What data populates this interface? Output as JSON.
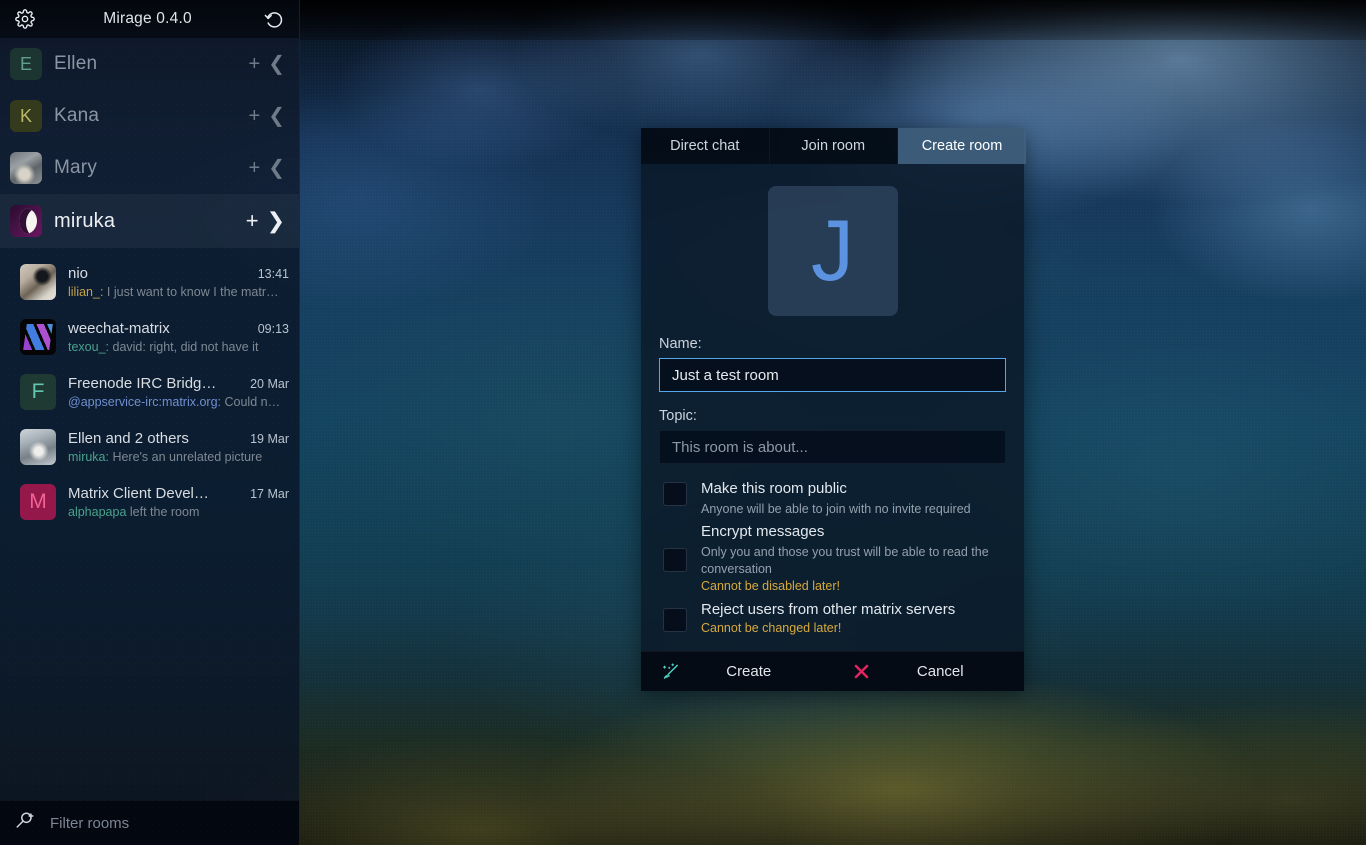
{
  "app": {
    "title": "Mirage 0.4.0",
    "settings_icon": "gear-icon",
    "reload_icon": "reload-icon"
  },
  "sidebar": {
    "accounts": [
      {
        "name": "Ellen",
        "initial": "E",
        "avatar": "letter",
        "add_icon": "plus-icon",
        "collapse_icon": "chevron-left-icon",
        "active": false
      },
      {
        "name": "Kana",
        "initial": "K",
        "avatar": "letter",
        "add_icon": "plus-icon",
        "collapse_icon": "chevron-left-icon",
        "active": false
      },
      {
        "name": "Mary",
        "initial": "",
        "avatar": "photo",
        "add_icon": "plus-icon",
        "collapse_icon": "chevron-left-icon",
        "active": false
      },
      {
        "name": "miruka",
        "initial": "",
        "avatar": "moon",
        "add_icon": "plus-icon",
        "collapse_icon": "chevron-down-icon",
        "active": true
      }
    ],
    "rooms": [
      {
        "name": "nio",
        "time": "13:41",
        "sender": "lilian_:",
        "sender_color": "#c3a24a",
        "preview": " I just want to know I the matr…"
      },
      {
        "name": "weechat-matrix",
        "time": "09:13",
        "sender": "texou_:",
        "sender_color": "#4aa38e",
        "preview": " david: right, did not have it"
      },
      {
        "name": "Freenode IRC Bridg…",
        "time": "20 Mar",
        "sender": "@appservice-irc:matrix.org:",
        "sender_color": "#6f8fd0",
        "preview": " Could n…"
      },
      {
        "name": "Ellen and 2 others",
        "time": "19 Mar",
        "sender": "miruka:",
        "sender_color": "#4aa38e",
        "preview": " Here's an unrelated picture"
      },
      {
        "name": "Matrix Client Devel…",
        "time": "17 Mar",
        "sender": "alphapapa",
        "sender_color": "#4aa38e",
        "preview": " left the room"
      }
    ],
    "filter": {
      "icon": "search-plus-icon",
      "placeholder": "Filter rooms"
    }
  },
  "dialog": {
    "tabs": [
      {
        "label": "Direct chat",
        "active": false
      },
      {
        "label": "Join room",
        "active": false
      },
      {
        "label": "Create room",
        "active": true
      }
    ],
    "avatar_letter": "J",
    "name_field": {
      "label": "Name:",
      "value": "Just a test room",
      "placeholder": "",
      "focused": true
    },
    "topic_field": {
      "label": "Topic:",
      "value": "",
      "placeholder": "This room is about...",
      "focused": false
    },
    "options": [
      {
        "title": "Make this room public",
        "subtitle": "Anyone will be able to join with no invite required",
        "warning": "",
        "checked": false
      },
      {
        "title": "Encrypt messages",
        "subtitle": "Only you and those you trust will be able to read the conversation",
        "warning": "Cannot be disabled later!",
        "checked": false
      },
      {
        "title": "Reject users from other matrix servers",
        "subtitle": "",
        "warning": "Cannot be changed later!",
        "checked": false
      }
    ],
    "buttons": [
      {
        "label": "Create",
        "icon": "magic-wand-icon",
        "icon_color": "#4fd6c8"
      },
      {
        "label": "Cancel",
        "icon": "cross-icon",
        "icon_color": "#e0245e"
      }
    ]
  },
  "colors": {
    "accent": "#54a7e8",
    "warning": "#d7a93c",
    "cancel": "#e0245e",
    "create": "#4fd6c8",
    "sidebar_bg": "#0a1426",
    "dialog_bg": "#0a1626",
    "tab_active_bg": "#40617e"
  }
}
